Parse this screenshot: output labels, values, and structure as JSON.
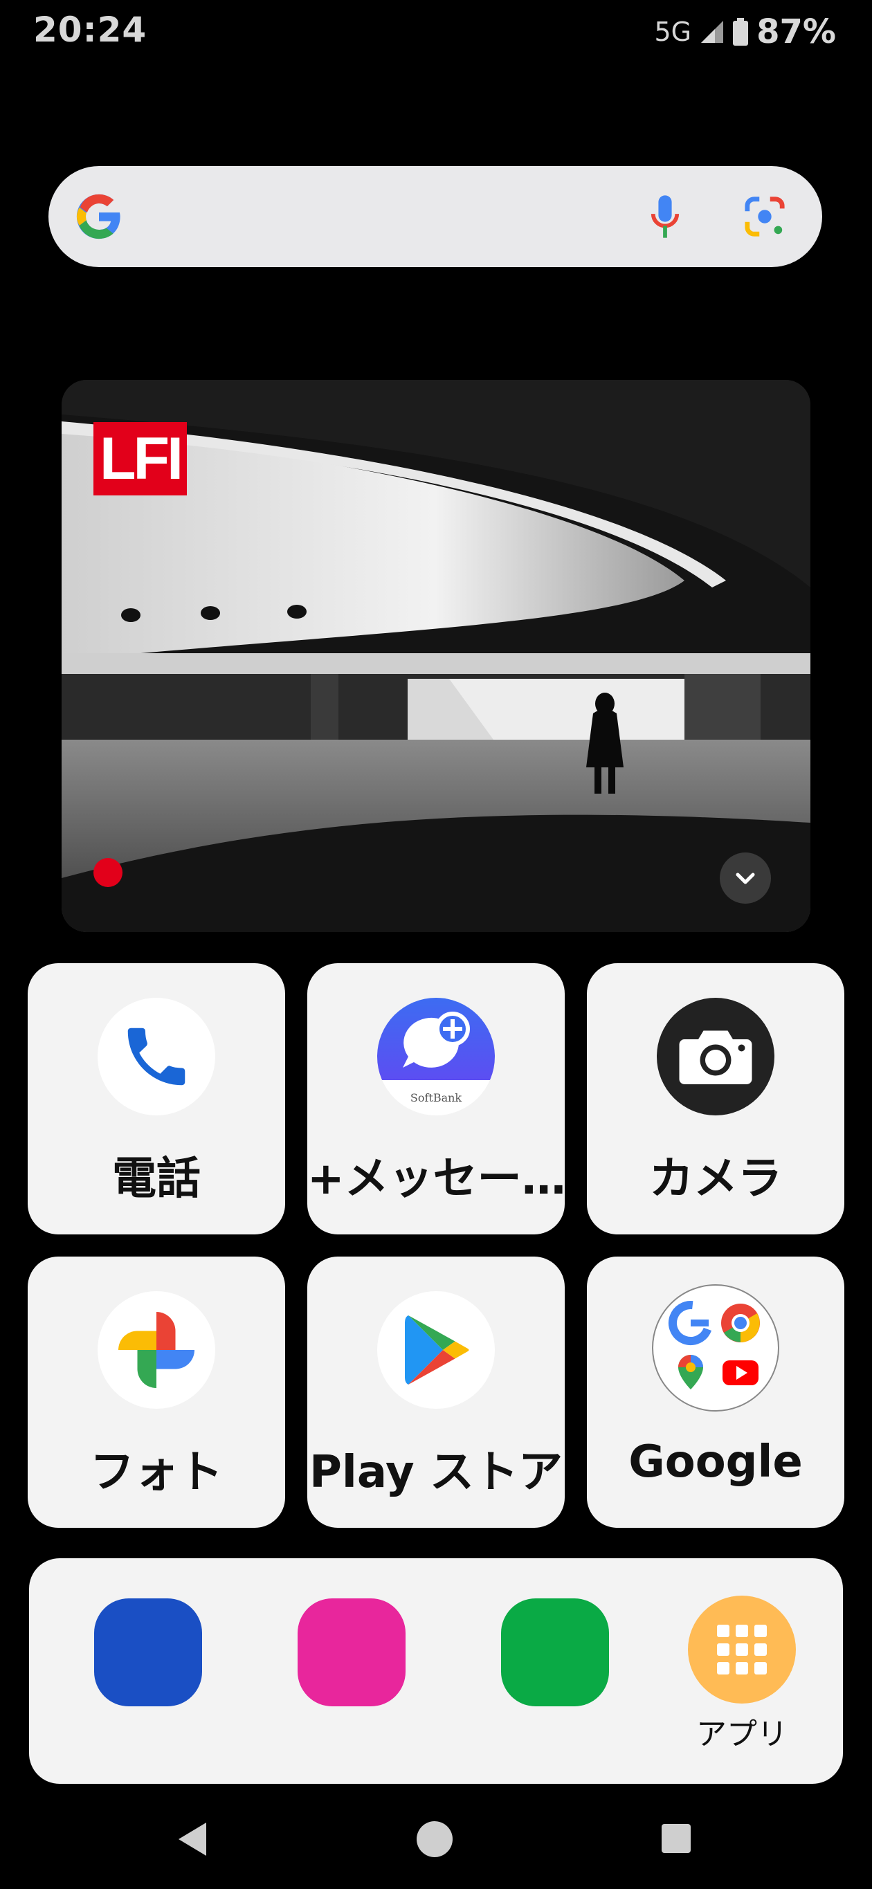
{
  "status_bar": {
    "time": "20:24",
    "network": "5G",
    "battery": "87%"
  },
  "search_bar": {
    "logo": "google-g-icon",
    "mic": "mic-icon",
    "lens": "lens-icon"
  },
  "photo_widget": {
    "badge": "LFI",
    "expand": "chevron-down-icon",
    "colors": {
      "badge": "#e2001a"
    }
  },
  "apps": [
    {
      "label": "電話",
      "icon": "phone-icon"
    },
    {
      "label": "+メッセー…",
      "icon": "message-icon",
      "sublabel": "SoftBank"
    },
    {
      "label": "カメラ",
      "icon": "camera-icon"
    },
    {
      "label": "フォト",
      "icon": "photos-icon"
    },
    {
      "label": "Play ストア",
      "icon": "play-store-icon"
    },
    {
      "label": "Google",
      "icon": "google-folder-icon"
    }
  ],
  "dock": {
    "shortcut_colors": [
      "#1a4fc4",
      "#e8269c",
      "#0aaa45"
    ],
    "apps_label": "アプリ",
    "apps_color": "#ffbb55"
  },
  "nav": {
    "back": "back-icon",
    "home": "home-icon",
    "recents": "recents-icon"
  }
}
